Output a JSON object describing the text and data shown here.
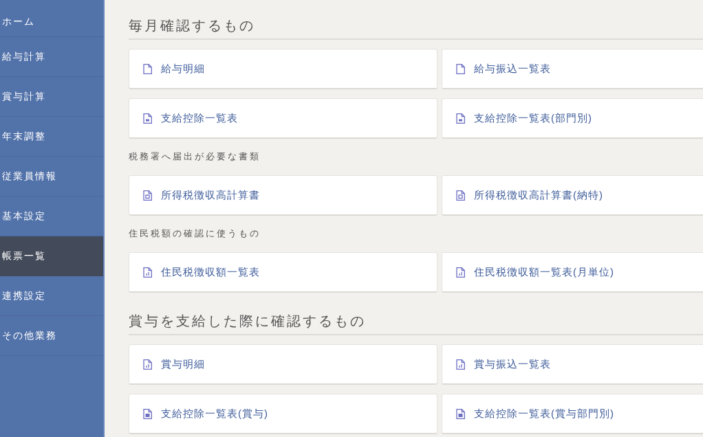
{
  "sidebar": {
    "items": [
      {
        "label": "ホーム",
        "selected": false
      },
      {
        "label": "給与計算",
        "selected": false
      },
      {
        "label": "賞与計算",
        "selected": false
      },
      {
        "label": "年末調整",
        "selected": false
      },
      {
        "label": "従業員情報",
        "selected": false
      },
      {
        "label": "基本設定",
        "selected": false
      },
      {
        "label": "帳票一覧",
        "selected": true
      },
      {
        "label": "連携設定",
        "selected": false
      },
      {
        "label": "その他業務",
        "selected": false
      }
    ]
  },
  "sections": [
    {
      "title": "毎月確認するもの",
      "groups": [
        {
          "items": [
            {
              "label": "給与明細",
              "kind": "plain"
            },
            {
              "label": "給与振込一覧表",
              "kind": "plain"
            },
            {
              "label": "支給控除一覧表",
              "kind": "table"
            },
            {
              "label": "支給控除一覧表(部門別)",
              "kind": "table"
            }
          ]
        },
        {
          "title": "税務署へ届出が必要な書類",
          "items": [
            {
              "label": "所得税徴収高計算書",
              "kind": "form"
            },
            {
              "label": "所得税徴収高計算書(納特)",
              "kind": "form"
            }
          ]
        },
        {
          "title": "住民税額の確認に使うもの",
          "items": [
            {
              "label": "住民税徴収額一覧表",
              "kind": "chart"
            },
            {
              "label": "住民税徴収額一覧表(月単位)",
              "kind": "chart"
            }
          ]
        }
      ]
    },
    {
      "title": "賞与を支給した際に確認するもの",
      "groups": [
        {
          "items": [
            {
              "label": "賞与明細",
              "kind": "chart"
            },
            {
              "label": "賞与振込一覧表",
              "kind": "chart"
            },
            {
              "label": "支給控除一覧表(賞与)",
              "kind": "stamp"
            },
            {
              "label": "支給控除一覧表(賞与部門別)",
              "kind": "stamp"
            }
          ]
        }
      ]
    }
  ]
}
